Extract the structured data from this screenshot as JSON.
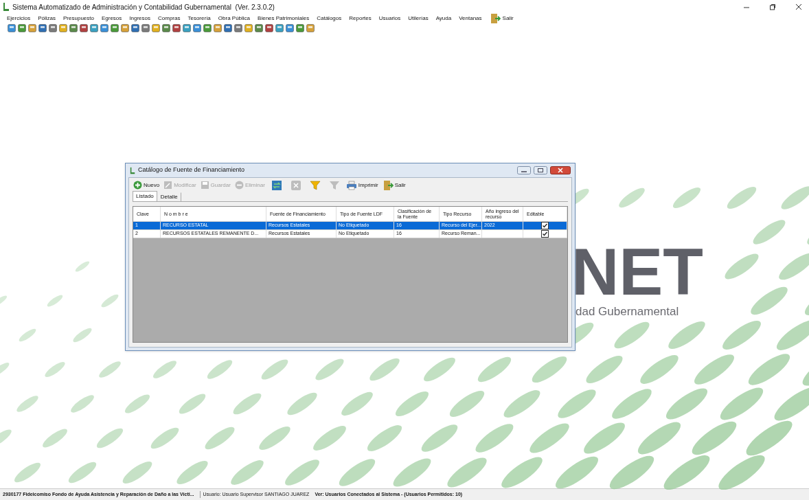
{
  "window": {
    "title": "Sistema Automatizado de Administración y Contabilidad Gubernamental  (Ver. 2.3.0.2)"
  },
  "menu": [
    {
      "label": "Ejercicios",
      "kind": "text"
    },
    {
      "label": "Pólizas",
      "kind": "text"
    },
    {
      "label": "Presupuesto",
      "kind": "text"
    },
    {
      "label": "Egresos",
      "kind": "text"
    },
    {
      "label": "Ingresos",
      "kind": "text"
    },
    {
      "label": "Compras",
      "kind": "text"
    },
    {
      "label": "Tesorería",
      "kind": "text"
    },
    {
      "label": "Obra Pública",
      "kind": "text"
    },
    {
      "label": "Bienes Patrimoniales",
      "kind": "text"
    },
    {
      "label": "Catálogos",
      "kind": "text"
    },
    {
      "label": "Reportes",
      "kind": "text"
    },
    {
      "label": "Usuarios",
      "kind": "text"
    },
    {
      "label": "Utilerías",
      "kind": "text"
    },
    {
      "label": "Ayuda",
      "kind": "text"
    },
    {
      "label": "Ventanas",
      "kind": "text"
    },
    {
      "label": "Salir",
      "kind": "exit"
    }
  ],
  "background_logo": {
    "letters": "NET",
    "subtitle": "dad Gubernamental"
  },
  "dialog": {
    "title": "Catálogo de Fuente de Financiamiento",
    "toolbar": [
      {
        "label": "Nuevo",
        "kind": "add",
        "disabled": false
      },
      {
        "label": "Modificar",
        "kind": "edit",
        "disabled": true
      },
      {
        "label": "Guardar",
        "kind": "save",
        "disabled": true
      },
      {
        "label": "Eliminar",
        "kind": "delete",
        "disabled": true
      },
      {
        "kind": "refresh",
        "disabled": false
      },
      {
        "kind": "cancel",
        "disabled": true
      },
      {
        "kind": "filter",
        "disabled": false
      },
      {
        "kind": "clear-filter",
        "disabled": true
      },
      {
        "label": "Imprimir",
        "kind": "print",
        "disabled": false
      },
      {
        "label": "Salir",
        "kind": "exit",
        "disabled": false
      }
    ],
    "tabs": [
      {
        "label": "Listado",
        "selected": true
      },
      {
        "label": "Detalle",
        "selected": false
      }
    ],
    "table": {
      "columns": [
        "Clave",
        "N o m b r e",
        "Fuente de Financiamiento",
        "Tipo de Fuente LDF",
        "Clasificación de la Fuente",
        "Tipo Recurso",
        "Año ingreso del recurso",
        "Editable"
      ],
      "rows": [
        {
          "cells": [
            "1",
            "RECURSO ESTATAL",
            "Recursos Estatales",
            "No Etiquetado",
            "16",
            "Recurso del Ejer...",
            "2022"
          ],
          "editable": true,
          "selected": true
        },
        {
          "cells": [
            "2",
            "RECURSOS ESTATALES REMANENTE D...",
            "Recursos Estatales",
            "No Etiquetado",
            "16",
            "Recurso Reman..."
          ],
          "editable": true,
          "selected": false
        }
      ]
    }
  },
  "status_bar": [
    "2930177 Fideicomiso Fondo de Ayuda Asistencia y Reparación de Daño a las Vícti...",
    "Usuario: Usuario Supervisor SANTIAGO JUAREZ",
    "Ver: Usuarios Conectados al Sistema - (Usuarios Permitidos: 10)"
  ]
}
